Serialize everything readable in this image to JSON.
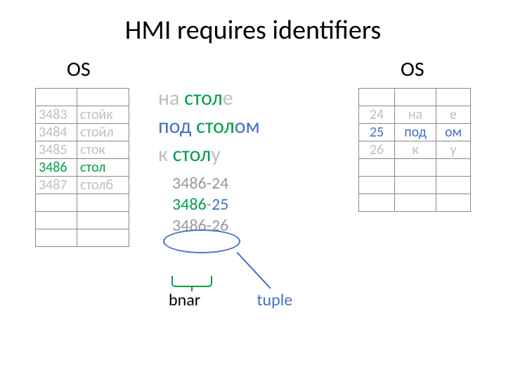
{
  "title": "HMI requires identifiers",
  "os_label": "OS",
  "left_table": {
    "rows": [
      {
        "id": "3483",
        "word": "стойк"
      },
      {
        "id": "3484",
        "word": "стойл"
      },
      {
        "id": "3485",
        "word": "сток"
      },
      {
        "id": "3486",
        "word": "стол"
      },
      {
        "id": "3487",
        "word": "столб"
      }
    ],
    "highlight_row": 3,
    "blank_rows": 3
  },
  "right_table": {
    "rows": [
      {
        "id": "24",
        "prep": "на",
        "suf": "е"
      },
      {
        "id": "25",
        "prep": "под",
        "suf": "ом"
      },
      {
        "id": "26",
        "prep": "к",
        "suf": "у"
      }
    ],
    "highlight_row": 1,
    "blank_rows": 3
  },
  "phrases": [
    {
      "parts": [
        {
          "t": "на ",
          "c": "grey"
        },
        {
          "t": "стол",
          "c": "green"
        },
        {
          "t": "е",
          "c": "grey"
        }
      ]
    },
    {
      "parts": [
        {
          "t": "под ",
          "c": "blue"
        },
        {
          "t": "стол",
          "c": "green"
        },
        {
          "t": "ом",
          "c": "blue"
        }
      ]
    },
    {
      "parts": [
        {
          "t": "к ",
          "c": "grey"
        },
        {
          "t": "стол",
          "c": "green"
        },
        {
          "t": "у",
          "c": "grey"
        }
      ]
    }
  ],
  "id_lines": [
    {
      "parts": [
        {
          "t": "3486",
          "c": "grey"
        },
        {
          "t": "-",
          "c": "grey"
        },
        {
          "t": "24",
          "c": "grey"
        }
      ]
    },
    {
      "parts": [
        {
          "t": "3486",
          "c": "green"
        },
        {
          "t": "-",
          "c": "grey"
        },
        {
          "t": "25",
          "c": "blue"
        }
      ]
    },
    {
      "parts": [
        {
          "t": "3486",
          "c": "grey"
        },
        {
          "t": "-",
          "c": "grey"
        },
        {
          "t": "26",
          "c": "grey"
        }
      ]
    }
  ],
  "labels": {
    "bnar": "bnar",
    "tuple": "tuple"
  }
}
